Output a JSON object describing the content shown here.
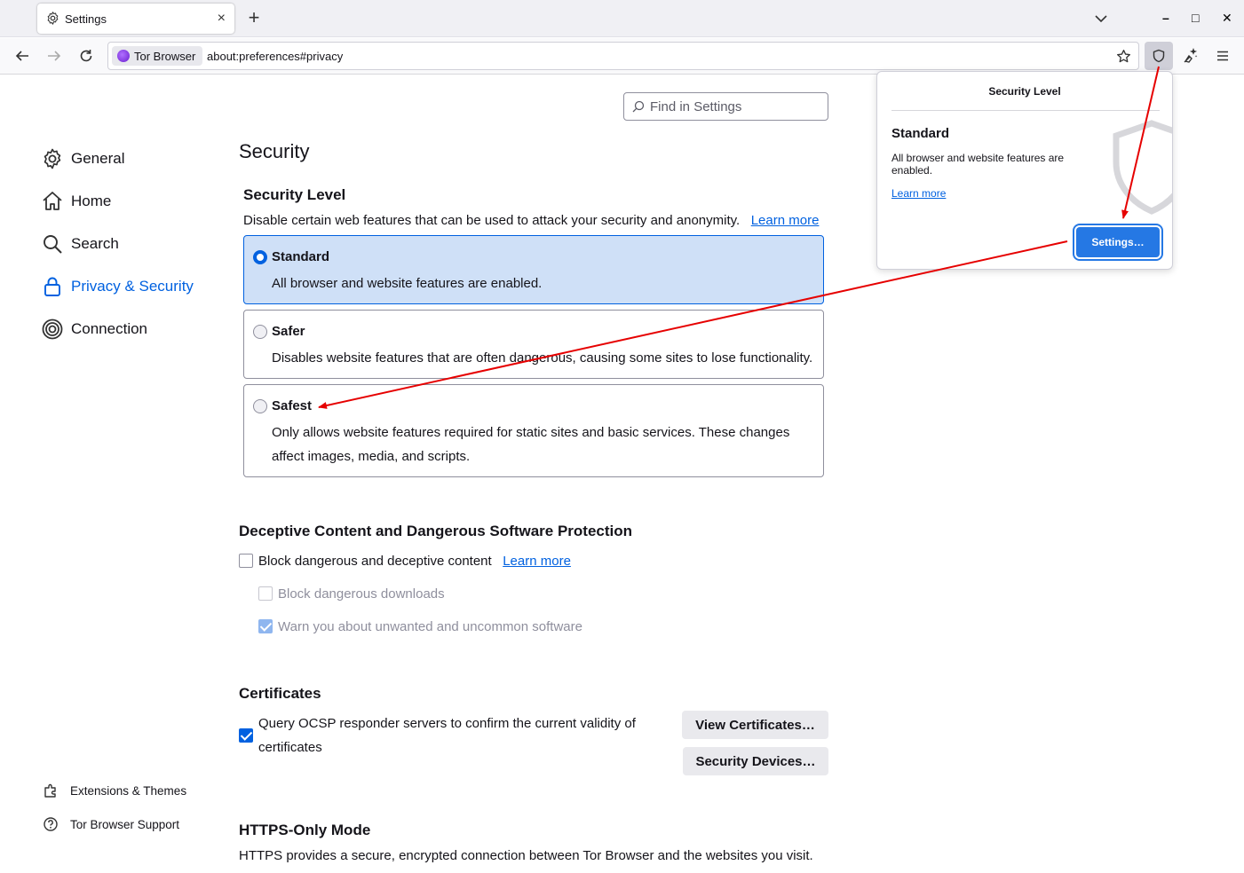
{
  "tab": {
    "title": "Settings",
    "close": "×",
    "new_tab": "+"
  },
  "window_controls": {
    "minimize": "–",
    "maximize": "□",
    "close": "✕"
  },
  "urlbar": {
    "identity_label": "Tor Browser",
    "url": "about:preferences#privacy"
  },
  "sidebar": {
    "items": [
      {
        "label": "General",
        "icon": "gear-icon"
      },
      {
        "label": "Home",
        "icon": "home-icon"
      },
      {
        "label": "Search",
        "icon": "search-icon"
      },
      {
        "label": "Privacy & Security",
        "icon": "lock-icon"
      },
      {
        "label": "Connection",
        "icon": "onion-icon"
      }
    ],
    "footer": [
      {
        "label": "Extensions & Themes",
        "icon": "puzzle-icon"
      },
      {
        "label": "Tor Browser Support",
        "icon": "help-icon"
      }
    ]
  },
  "find": {
    "placeholder": "Find in Settings"
  },
  "security": {
    "heading": "Security",
    "level_heading": "Security Level",
    "level_desc": "Disable certain web features that can be used to attack your security and anonymity.",
    "learn_more": "Learn more",
    "levels": [
      {
        "name": "Standard",
        "desc": "All browser and website features are enabled.",
        "selected": true
      },
      {
        "name": "Safer",
        "desc": "Disables website features that are often dangerous, causing some sites to lose functionality.",
        "selected": false
      },
      {
        "name": "Safest",
        "desc": "Only allows website features required for static sites and basic services. These changes affect images, media, and scripts.",
        "selected": false
      }
    ]
  },
  "deceptive": {
    "heading": "Deceptive Content and Dangerous Software Protection",
    "block_label": "Block dangerous and deceptive content",
    "learn_more": "Learn more",
    "block_downloads": "Block dangerous downloads",
    "warn_unwanted": "Warn you about unwanted and uncommon software"
  },
  "certificates": {
    "heading": "Certificates",
    "ocsp_label": "Query OCSP responder servers to confirm the current validity of certificates",
    "view_button": "View Certificates…",
    "devices_button": "Security Devices…"
  },
  "https_only": {
    "heading": "HTTPS-Only Mode",
    "desc": "HTTPS provides a secure, encrypted connection between Tor Browser and the websites you visit."
  },
  "popup": {
    "title": "Security Level",
    "level": "Standard",
    "desc": "All browser and website features are enabled.",
    "learn_more": "Learn more",
    "settings_button": "Settings…"
  },
  "colors": {
    "accent": "#0061e0",
    "selected_bg": "#cfe0f7",
    "annotation": "#e60000"
  }
}
